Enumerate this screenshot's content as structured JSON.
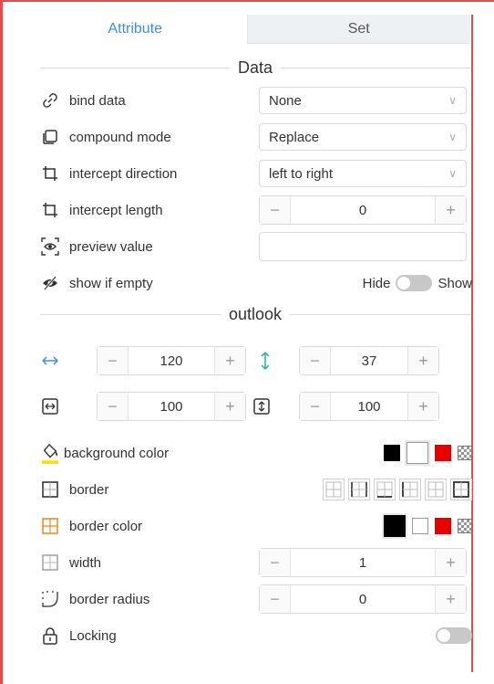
{
  "tabs": [
    {
      "label": "Attribute",
      "active": true
    },
    {
      "label": "Set",
      "active": false
    }
  ],
  "sections": {
    "data_title": "Data",
    "outlook_title": "outlook"
  },
  "data_rows": {
    "bind_data": {
      "label": "bind data",
      "value": "None",
      "icon": "link-icon"
    },
    "compound_mode": {
      "label": "compound mode",
      "value": "Replace",
      "icon": "square-icon"
    },
    "intercept_direction": {
      "label": "intercept direction",
      "value": "left to right",
      "icon": "crop-icon"
    },
    "intercept_length": {
      "label": "intercept length",
      "value": "0",
      "icon": "crop-icon"
    },
    "preview_value": {
      "label": "preview value",
      "value": "",
      "icon": "eye-icon"
    },
    "show_if_empty": {
      "label": "show if empty",
      "hide_label": "Hide",
      "show_label": "Show",
      "icon": "eye-off-icon"
    }
  },
  "outlook": {
    "width_value": "120",
    "height_value": "37",
    "width_percent": "100",
    "height_percent": "100",
    "background_color": {
      "label": "background color",
      "icon": "paint-bucket-icon"
    },
    "border": {
      "label": "border",
      "icon": "border-grid-icon"
    },
    "border_color": {
      "label": "border color",
      "icon": "border-color-icon"
    },
    "border_width": {
      "label": "width",
      "value": "1",
      "icon": "border-width-icon"
    },
    "border_radius": {
      "label": "border radius",
      "value": "0",
      "icon": "radius-icon"
    },
    "locking": {
      "label": "Locking",
      "icon": "lock-icon"
    }
  },
  "colors": {
    "accent": "#3b8ee6",
    "frame": "#e84a4a",
    "black": "#000000",
    "white": "#ffffff",
    "red": "#e60000",
    "highlight": "#f5e100"
  }
}
